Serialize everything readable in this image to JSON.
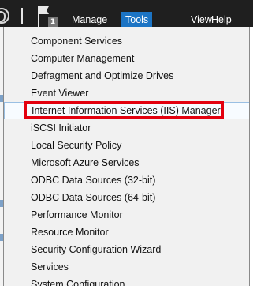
{
  "toolbar": {
    "notification_count": "1",
    "menus": [
      "Manage",
      "Tools",
      "View",
      "Help"
    ],
    "active_menu": "Tools"
  },
  "tools_menu": {
    "items": [
      "Component Services",
      "Computer Management",
      "Defragment and Optimize Drives",
      "Event Viewer",
      "Internet Information Services (IIS) Manager",
      "iSCSI Initiator",
      "Local Security Policy",
      "Microsoft Azure Services",
      "ODBC Data Sources (32-bit)",
      "ODBC Data Sources (64-bit)",
      "Performance Monitor",
      "Resource Monitor",
      "Security Configuration Wizard",
      "Services",
      "System Configuration"
    ],
    "selected_item": "Internet Information Services (IIS) Manager"
  },
  "colors": {
    "toolbar_bg": "#1f1f1f",
    "active_menu_bg": "#1c74c4",
    "highlight_box": "#e3000f",
    "menu_bg": "#f1f1f1"
  }
}
